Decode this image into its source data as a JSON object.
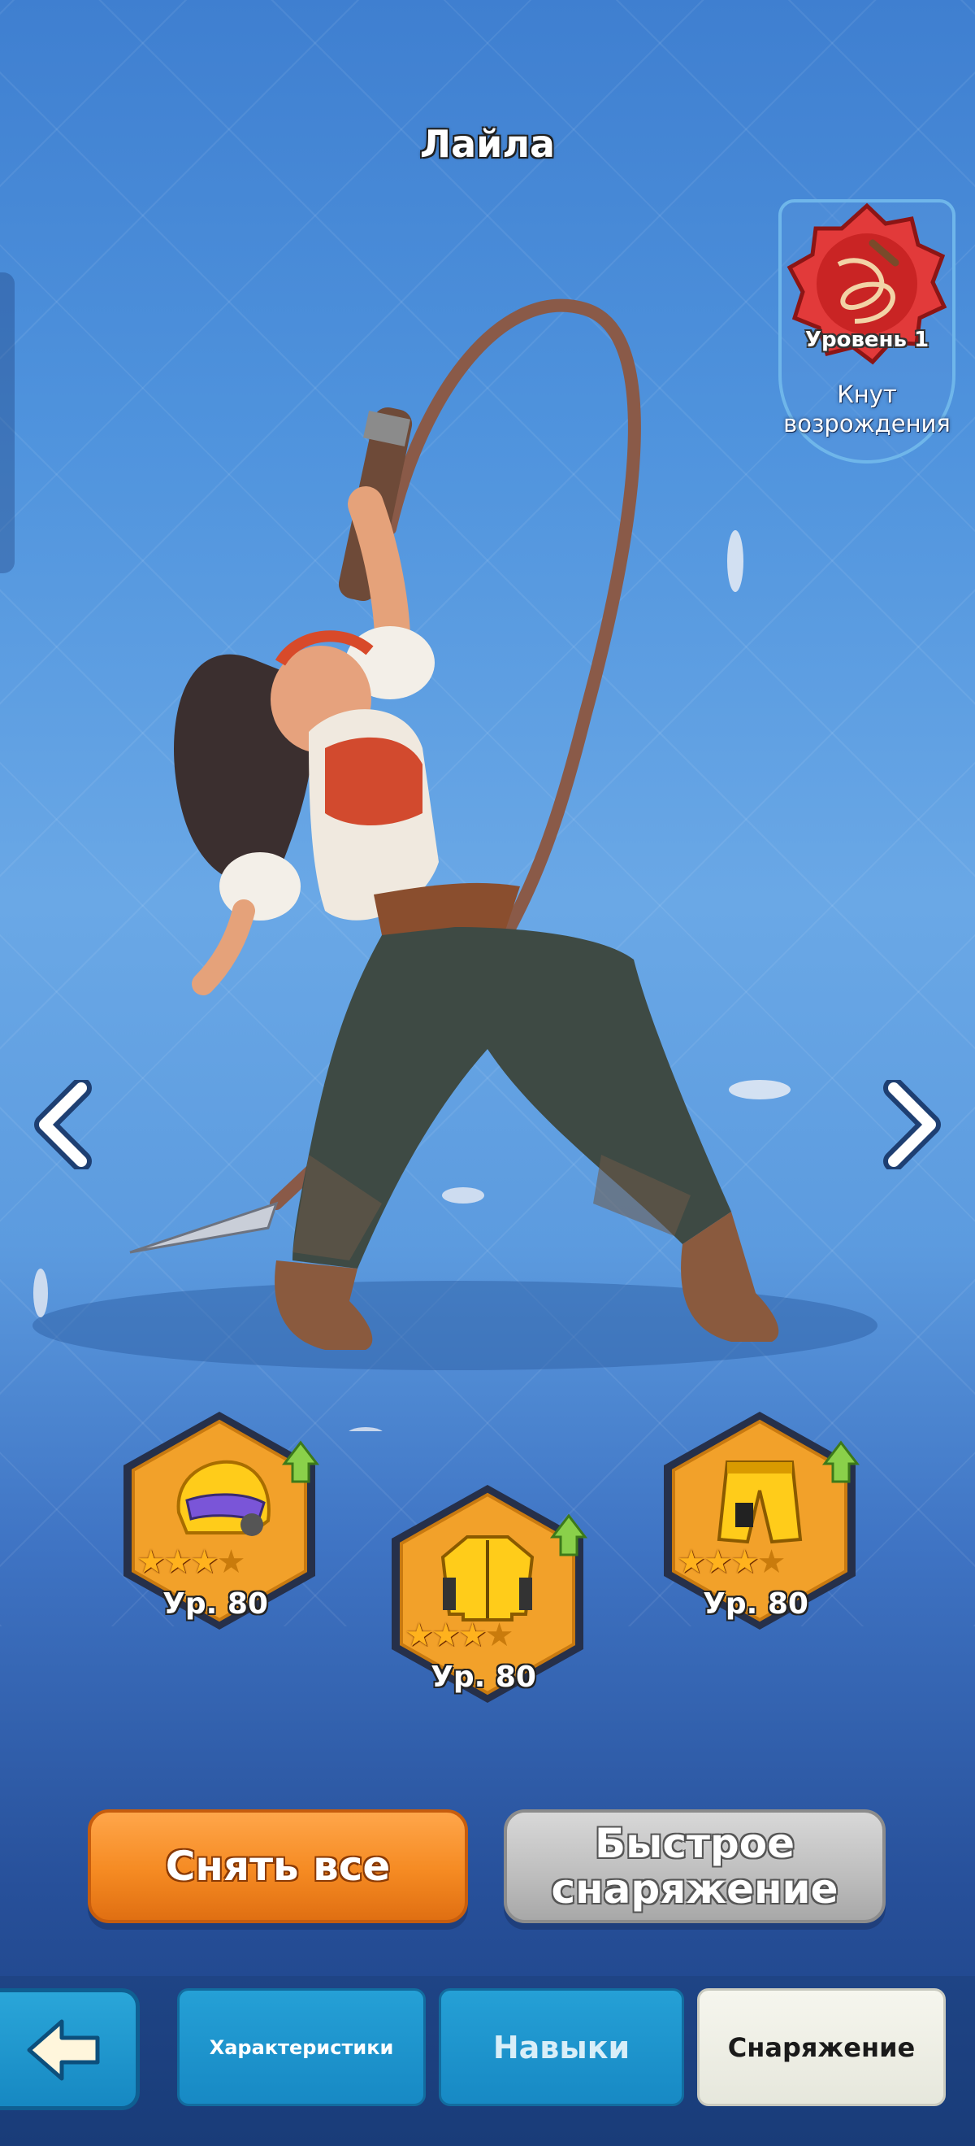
{
  "hero": {
    "name": "Лайла"
  },
  "weapon": {
    "level_label": "Уровень 1",
    "name": "Кнут возрождения",
    "icon": "whip-icon",
    "badge_color": "#e23a3a"
  },
  "navigation": {
    "prev_icon": "chevron-left-icon",
    "next_icon": "chevron-right-icon"
  },
  "equipment": [
    {
      "slot": "helmet",
      "icon": "helmet-icon",
      "stars": 3,
      "max_stars": 4,
      "level_label": "Ур. 80",
      "upgrade_available": true
    },
    {
      "slot": "armor",
      "icon": "jacket-icon",
      "stars": 3,
      "max_stars": 4,
      "level_label": "Ур. 80",
      "upgrade_available": true
    },
    {
      "slot": "pants",
      "icon": "pants-icon",
      "stars": 3,
      "max_stars": 4,
      "level_label": "Ур. 80",
      "upgrade_available": true
    }
  ],
  "actions": {
    "unequip_all": "Снять все",
    "quick_equip": "Быстрое снаряжение"
  },
  "tabs": [
    {
      "label": "Характеристики",
      "active": false
    },
    {
      "label": "Навыки",
      "active": false
    },
    {
      "label": "Снаряжение",
      "active": true
    }
  ],
  "colors": {
    "accent_orange": "#f58a22",
    "tab_blue": "#1789c4",
    "gear_gold": "#f2a12a"
  }
}
